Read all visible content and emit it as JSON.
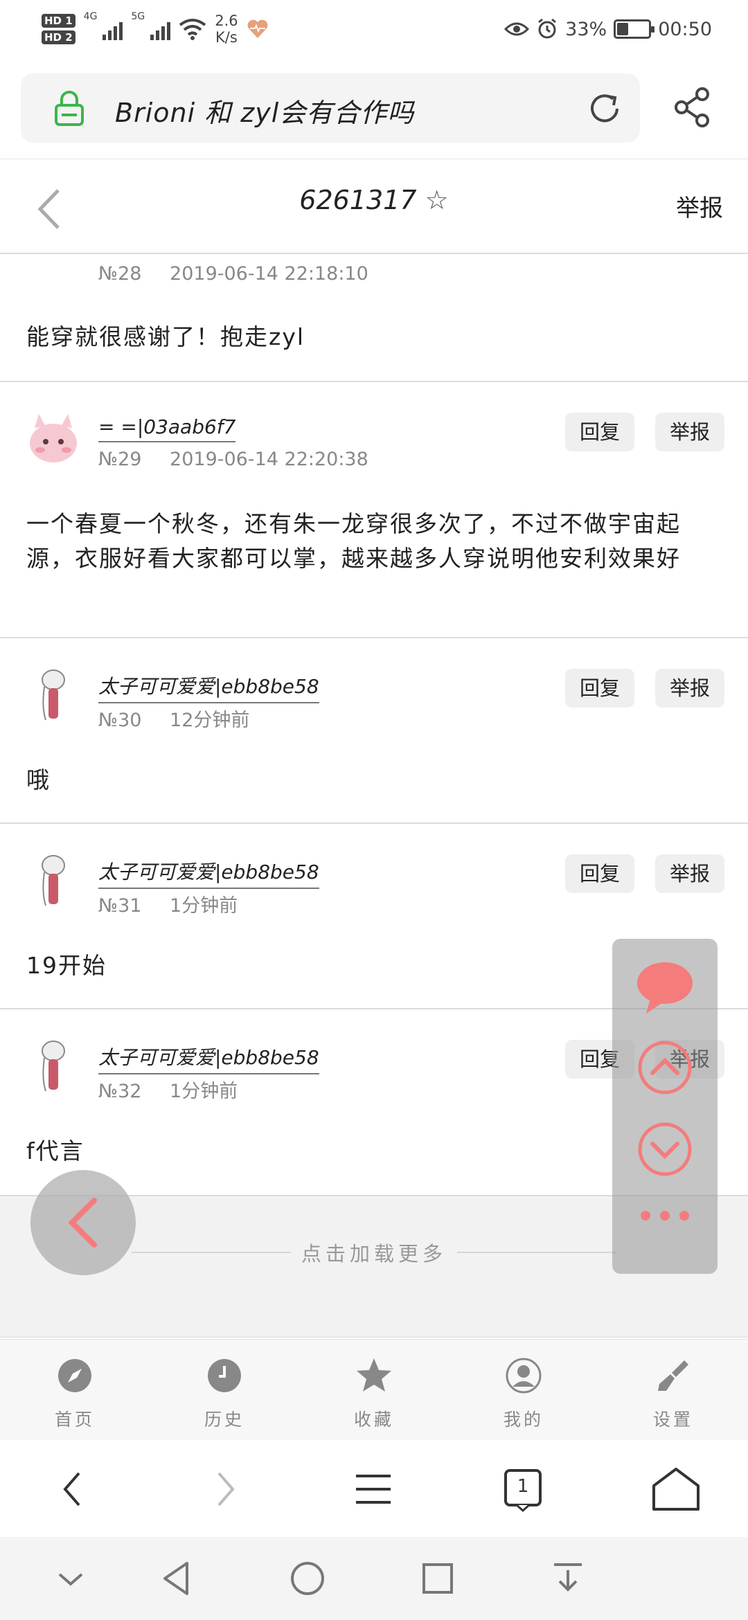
{
  "status": {
    "hd1": "HD 1",
    "hd2": "HD 2",
    "net1": "4G",
    "net2": "5G",
    "speed_value": "2.6",
    "speed_unit": "K/s",
    "battery_percent": "33%",
    "battery_level": 0.33,
    "time": "00:50"
  },
  "address": {
    "url": "Brioni 和 zyl会有合作吗"
  },
  "thread": {
    "title": "6261317",
    "star": "☆",
    "report": "举报"
  },
  "posts": [
    {
      "number": "№28",
      "time": "2019-06-14 22:18:10",
      "username": "",
      "content": "能穿就很感谢了！抱走zyl"
    },
    {
      "number": "№29",
      "time": "2019-06-14 22:20:38",
      "username": "= =|03aab6f7",
      "content": "一个春夏一个秋冬，还有朱一龙穿很多次了，不过不做宇宙起源，衣服好看大家都可以掌，越来越多人穿说明他安利效果好",
      "reply": "回复",
      "report": "举报"
    },
    {
      "number": "№30",
      "time": "12分钟前",
      "username": "太子可可爱爱|ebb8be58",
      "content": "哦",
      "reply": "回复",
      "report": "举报"
    },
    {
      "number": "№31",
      "time": "1分钟前",
      "username": "太子可可爱爱|ebb8be58",
      "content": "19开始",
      "reply": "回复",
      "report": "举报"
    },
    {
      "number": "№32",
      "time": "1分钟前",
      "username": "太子可可爱爱|ebb8be58",
      "content": "f代言",
      "reply": "回复",
      "report": "举报"
    }
  ],
  "loadmore": {
    "label": "点击加载更多"
  },
  "bottom_nav": [
    {
      "label": "首页",
      "icon": "compass-icon"
    },
    {
      "label": "历史",
      "icon": "clock-icon"
    },
    {
      "label": "收藏",
      "icon": "star-icon"
    },
    {
      "label": "我的",
      "icon": "user-icon"
    },
    {
      "label": "设置",
      "icon": "brush-icon"
    }
  ],
  "toolbar": {
    "tab_count": "1"
  },
  "colors": {
    "accent_red": "#f47c7c",
    "lock_green": "#3cb54a"
  }
}
